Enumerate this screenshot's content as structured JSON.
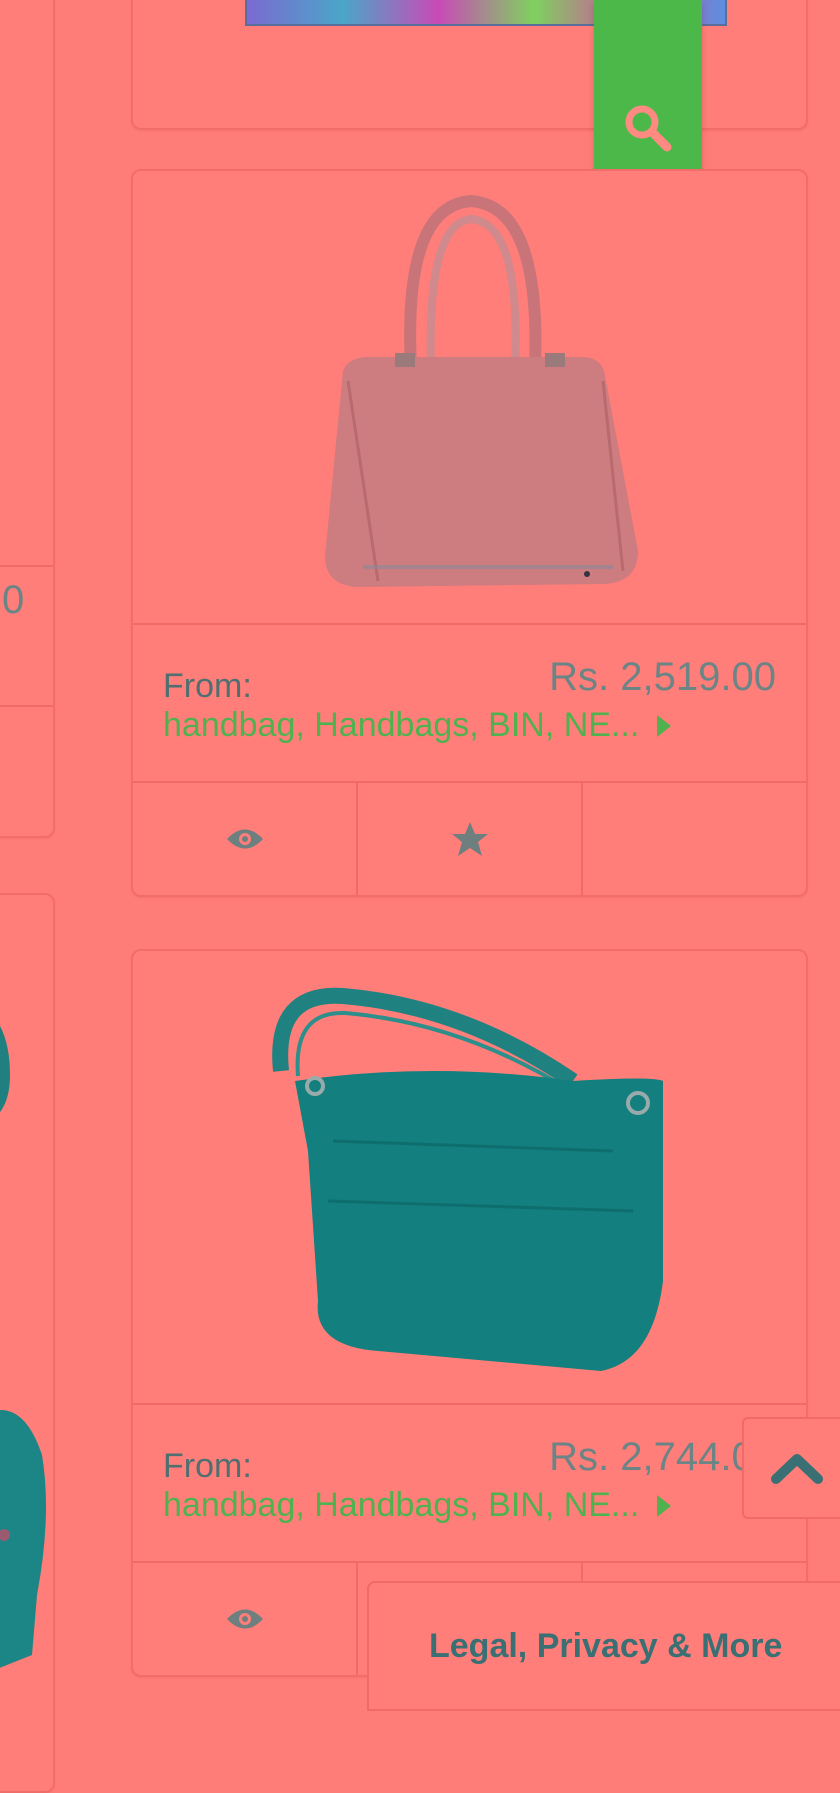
{
  "products": [
    {
      "from_label": "From:",
      "price": "Rs. 2,519.00",
      "categories": "handbag, Handbags, BIN, NE...",
      "image": "handbag-photo"
    },
    {
      "from_label": "From:",
      "price": "Rs. 2,744.00",
      "categories": "handbag, Handbags, BIN, NE...",
      "image": "shoulder-bag-photo"
    }
  ],
  "left_column": {
    "price_fragment": "0"
  },
  "footer": {
    "legal_label": "Legal, Privacy & More"
  },
  "icons": {
    "search": "search-icon",
    "view": "eye-icon",
    "favorite": "star-icon",
    "back_to_top": "chevron-up-icon"
  },
  "colors": {
    "background": "#ff7d78",
    "accent_green": "#4cb84a",
    "category_link": "#4fb24f",
    "legal_text": "#3a6f73"
  }
}
